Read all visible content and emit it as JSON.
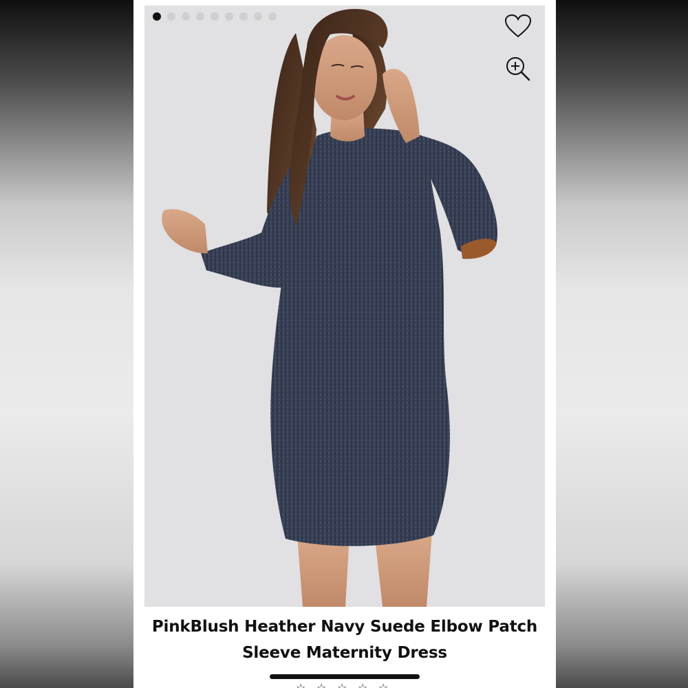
{
  "product": {
    "title_line1": "PinkBlush Heather Navy Suede Elbow Patch",
    "title_line2": "Sleeve Maternity Dress"
  },
  "gallery": {
    "image_count": 9,
    "active_index": 0
  },
  "icons": {
    "favorite": "heart-icon",
    "zoom": "zoom-in-icon",
    "rating_star": "star-icon"
  },
  "colors": {
    "dress_navy": "#3a4258",
    "suede_patch": "#9a5a2c",
    "photo_background": "#e1e0e2",
    "text": "#111111"
  }
}
